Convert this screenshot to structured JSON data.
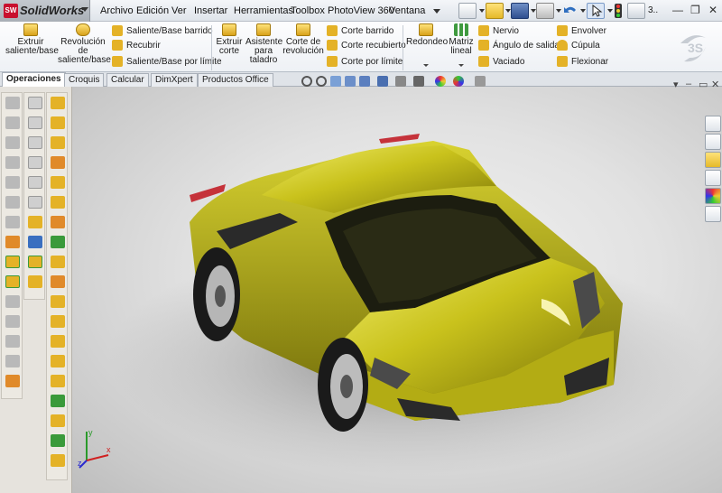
{
  "app": {
    "name": "SolidWorks",
    "brand_mark": "SW"
  },
  "menu": {
    "items": [
      "Archivo",
      "Edición",
      "Ver",
      "Insertar",
      "Herramientas",
      "Toolbox",
      "PhotoView 360",
      "Ventana"
    ],
    "trailing_text": "3.."
  },
  "ribbon": {
    "big_buttons": [
      {
        "label": "Extruir saliente/base",
        "icon": "extrude-boss-icon"
      },
      {
        "label": "Revolución de saliente/base",
        "icon": "revolve-boss-icon"
      },
      {
        "label": "Extruir corte",
        "icon": "extrude-cut-icon"
      },
      {
        "label": "Asistente para taladro",
        "icon": "hole-wizard-icon"
      },
      {
        "label": "Corte de revolución",
        "icon": "revolve-cut-icon"
      },
      {
        "label": "Redondeo",
        "icon": "fillet-icon"
      },
      {
        "label": "Matriz lineal",
        "icon": "linear-pattern-icon"
      }
    ],
    "group_boss": [
      "Saliente/Base barrido",
      "Recubrir",
      "Saliente/Base por límite"
    ],
    "group_cut": [
      "Corte barrido",
      "Corte recubierto",
      "Corte por límite"
    ],
    "group_features": [
      "Nervio",
      "Ángulo de salida",
      "Vaciado"
    ],
    "group_extra": [
      "Envolver",
      "Cúpula",
      "Flexionar"
    ]
  },
  "tabs": [
    {
      "label": "Operaciones",
      "active": true
    },
    {
      "label": "Croquis",
      "active": false
    },
    {
      "label": "Calcular",
      "active": false
    },
    {
      "label": "DimXpert",
      "active": false
    },
    {
      "label": "Productos Office",
      "active": false
    }
  ],
  "colors": {
    "car_body": "#c9c21c",
    "car_highlight": "#f0ec6a",
    "car_shadow": "#6f6a08",
    "logo_red": "#c8102e"
  }
}
